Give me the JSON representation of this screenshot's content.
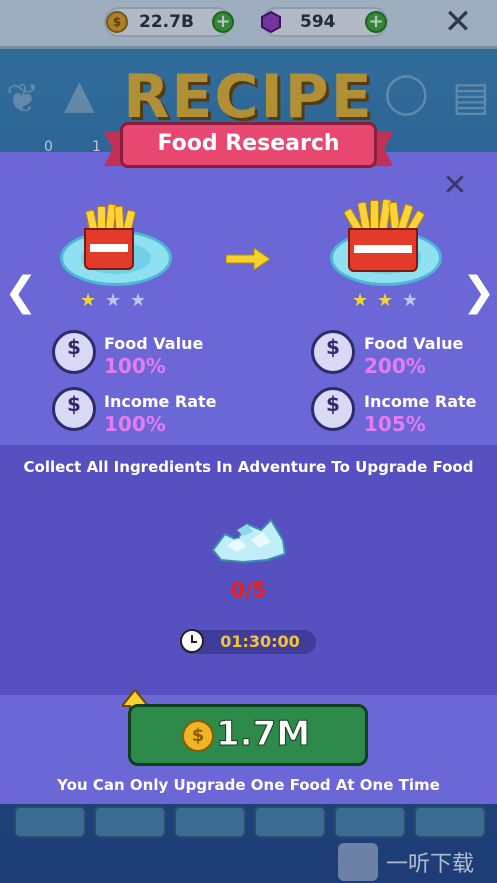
{
  "topbar": {
    "coins": "22.7B",
    "gems": "594"
  },
  "background": {
    "title": "RECIPE",
    "digits": [
      "0",
      "1"
    ]
  },
  "dialog": {
    "title": "Food Research",
    "current": {
      "stars": [
        true,
        false,
        false
      ],
      "food_value_label": "Food Value",
      "food_value": "100%",
      "income_rate_label": "Income Rate",
      "income_rate": "100%"
    },
    "next": {
      "stars": [
        true,
        true,
        false
      ],
      "food_value_label": "Food Value",
      "food_value": "200%",
      "income_rate_label": "Income Rate",
      "income_rate": "105%"
    },
    "collect_text": "Collect All Ingredients In Adventure To Upgrade Food",
    "ingredient_count": "0/5",
    "timer": "01:30:00",
    "upgrade_price": "1.7M",
    "notice": "You Can Only Upgrade One Food At One Time"
  },
  "watermark": "一听下载",
  "colors": {
    "panel": "#5d59c8",
    "ribbon": "#e8476f",
    "upgrade_button": "#2e8a4a",
    "stat_value": "#e57cf0",
    "count": "#e8201a",
    "timer_text": "#f3c43a",
    "star_filled": "#f2d33a",
    "star_empty": "#b9c7f0"
  }
}
